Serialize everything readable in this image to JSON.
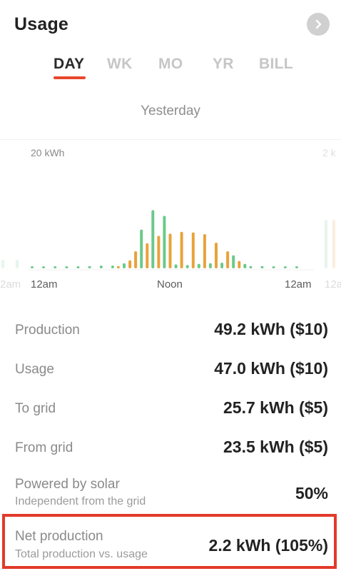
{
  "header": {
    "title": "Usage"
  },
  "tabs": [
    {
      "label": "DAY",
      "active": true
    },
    {
      "label": "WK",
      "active": false
    },
    {
      "label": "MO",
      "active": false
    },
    {
      "label": "YR",
      "active": false
    },
    {
      "label": "BILL",
      "active": false
    }
  ],
  "period_label": "Yesterday",
  "chart_data": {
    "type": "bar",
    "ylabel_top": "20 kWh",
    "y_max_label_ghost": "2 k",
    "x_tick_labels": [
      "12am",
      "Noon",
      "12am"
    ],
    "ghost_left_label": "2am",
    "ghost_right_label": "12a",
    "ylim": [
      0,
      20
    ],
    "series": [
      {
        "name": "production",
        "color": "#6cc98a"
      },
      {
        "name": "usage",
        "color": "#e9a23b"
      }
    ],
    "bars": [
      {
        "hour": 0,
        "series": "production",
        "value": 0.3
      },
      {
        "hour": 1,
        "series": "production",
        "value": 0.3
      },
      {
        "hour": 2,
        "series": "production",
        "value": 0.3
      },
      {
        "hour": 3,
        "series": "production",
        "value": 0.3
      },
      {
        "hour": 4,
        "series": "production",
        "value": 0.3
      },
      {
        "hour": 5,
        "series": "production",
        "value": 0.4
      },
      {
        "hour": 6,
        "series": "production",
        "value": 0.5
      },
      {
        "hour": 7,
        "series": "production",
        "value": 0.5
      },
      {
        "hour": 7.5,
        "series": "usage",
        "value": 0.4
      },
      {
        "hour": 8,
        "series": "production",
        "value": 0.9
      },
      {
        "hour": 8.5,
        "series": "usage",
        "value": 1.4
      },
      {
        "hour": 9,
        "series": "usage",
        "value": 3.0
      },
      {
        "hour": 9.5,
        "series": "production",
        "value": 6.8
      },
      {
        "hour": 10,
        "series": "usage",
        "value": 4.4
      },
      {
        "hour": 10.5,
        "series": "production",
        "value": 10.2
      },
      {
        "hour": 11,
        "series": "usage",
        "value": 5.7
      },
      {
        "hour": 11.5,
        "series": "production",
        "value": 9.2
      },
      {
        "hour": 12,
        "series": "usage",
        "value": 6.1
      },
      {
        "hour": 12.5,
        "series": "production",
        "value": 0.7
      },
      {
        "hour": 13,
        "series": "usage",
        "value": 6.4
      },
      {
        "hour": 13.5,
        "series": "production",
        "value": 0.6
      },
      {
        "hour": 14,
        "series": "usage",
        "value": 6.3
      },
      {
        "hour": 14.5,
        "series": "production",
        "value": 0.8
      },
      {
        "hour": 15,
        "series": "usage",
        "value": 6.0
      },
      {
        "hour": 15.5,
        "series": "production",
        "value": 0.9
      },
      {
        "hour": 16,
        "series": "usage",
        "value": 4.5
      },
      {
        "hour": 16.5,
        "series": "production",
        "value": 1.0
      },
      {
        "hour": 17,
        "series": "usage",
        "value": 3.0
      },
      {
        "hour": 17.5,
        "series": "production",
        "value": 2.3
      },
      {
        "hour": 18,
        "series": "usage",
        "value": 1.3
      },
      {
        "hour": 18.5,
        "series": "production",
        "value": 0.8
      },
      {
        "hour": 19,
        "series": "production",
        "value": 0.4
      },
      {
        "hour": 20,
        "series": "production",
        "value": 0.4
      },
      {
        "hour": 21,
        "series": "production",
        "value": 0.3
      },
      {
        "hour": 22,
        "series": "production",
        "value": 0.3
      },
      {
        "hour": 23,
        "series": "production",
        "value": 0.3
      }
    ]
  },
  "stats": [
    {
      "label": "Production",
      "value": "49.2 kWh ($10)"
    },
    {
      "label": "Usage",
      "value": "47.0 kWh ($10)"
    },
    {
      "label": "To grid",
      "value": "25.7 kWh ($5)"
    },
    {
      "label": "From grid",
      "value": "23.5 kWh ($5)"
    },
    {
      "label": "Powered by solar",
      "sub": "Independent from the grid",
      "value": "50%"
    },
    {
      "label": "Net production",
      "sub": "Total production vs. usage",
      "value": "2.2 kWh (105%)"
    }
  ],
  "colors": {
    "accent": "#e8472d",
    "production": "#6cc98a",
    "usage": "#e9a23b",
    "highlight_border": "#e23a2a"
  }
}
